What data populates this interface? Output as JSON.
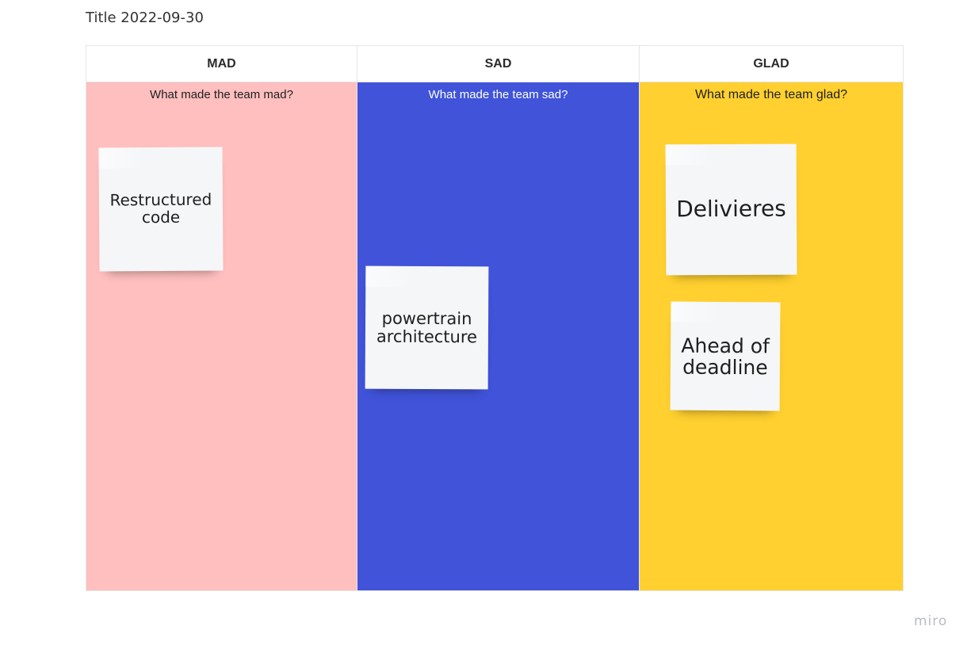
{
  "board": {
    "title": "Title 2022-09-30"
  },
  "columns": [
    {
      "header": "MAD",
      "prompt": "What made the team mad?",
      "color": "#ffbfbf",
      "prompt_color": "#1f1f1f",
      "notes": [
        "Restructured code"
      ]
    },
    {
      "header": "SAD",
      "prompt": "What made the team sad?",
      "color": "#4053d9",
      "prompt_color": "#ffffff",
      "notes": [
        "powertrain architecture"
      ]
    },
    {
      "header": "GLAD",
      "prompt": "What made the team glad?",
      "color": "#ffd02f",
      "prompt_color": "#1f1f1f",
      "notes": [
        "Delivieres",
        "Ahead of deadline"
      ]
    }
  ],
  "branding": {
    "logo_text": "miro"
  },
  "colors": {
    "sticky_note": "#f5f6f8",
    "logo": "#b9bcc4"
  }
}
